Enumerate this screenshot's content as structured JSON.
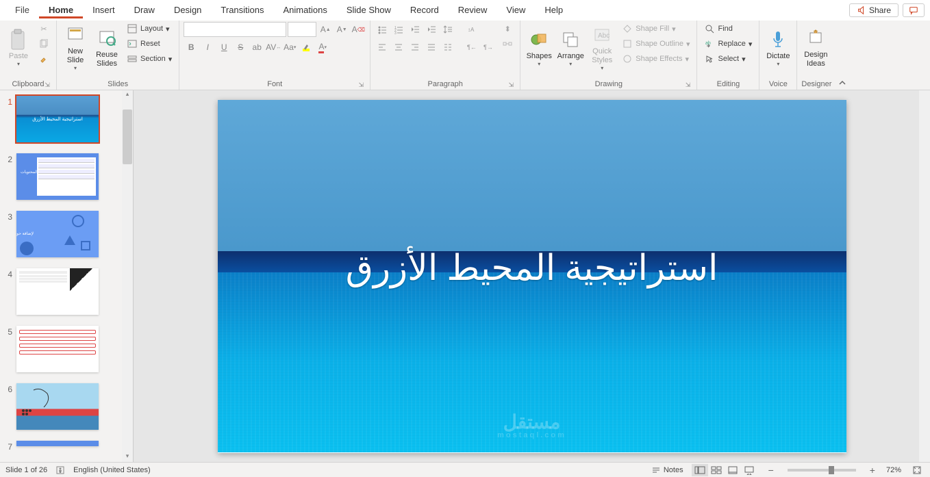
{
  "menu": {
    "items": [
      "File",
      "Home",
      "Insert",
      "Draw",
      "Design",
      "Transitions",
      "Animations",
      "Slide Show",
      "Record",
      "Review",
      "View",
      "Help"
    ],
    "active": "Home",
    "share": "Share"
  },
  "ribbon": {
    "clipboard": {
      "label": "Clipboard",
      "paste": "Paste"
    },
    "slides": {
      "label": "Slides",
      "new": "New Slide",
      "reuse": "Reuse Slides",
      "layout": "Layout",
      "reset": "Reset",
      "section": "Section"
    },
    "font": {
      "label": "Font"
    },
    "paragraph": {
      "label": "Paragraph"
    },
    "drawing": {
      "label": "Drawing",
      "shapes": "Shapes",
      "arrange": "Arrange",
      "quick": "Quick Styles",
      "fill": "Shape Fill",
      "outline": "Shape Outline",
      "effects": "Shape Effects"
    },
    "editing": {
      "label": "Editing",
      "find": "Find",
      "replace": "Replace",
      "select": "Select"
    },
    "voice": {
      "label": "Voice",
      "dictate": "Dictate"
    },
    "designer": {
      "label": "Designer",
      "ideas": "Design Ideas"
    }
  },
  "slide": {
    "title": "استراتيجية المحيط الأزرق",
    "watermark": "مستقل",
    "watermark_sub": "mostaql.com"
  },
  "thumbnails": {
    "count": 7,
    "slide2_side": "المحتويات",
    "slide3_text": "لإضافة حول استراتيجية المحيط الأزرق"
  },
  "status": {
    "slide": "Slide 1 of 26",
    "lang": "English (United States)",
    "notes": "Notes",
    "zoom": "72%"
  }
}
